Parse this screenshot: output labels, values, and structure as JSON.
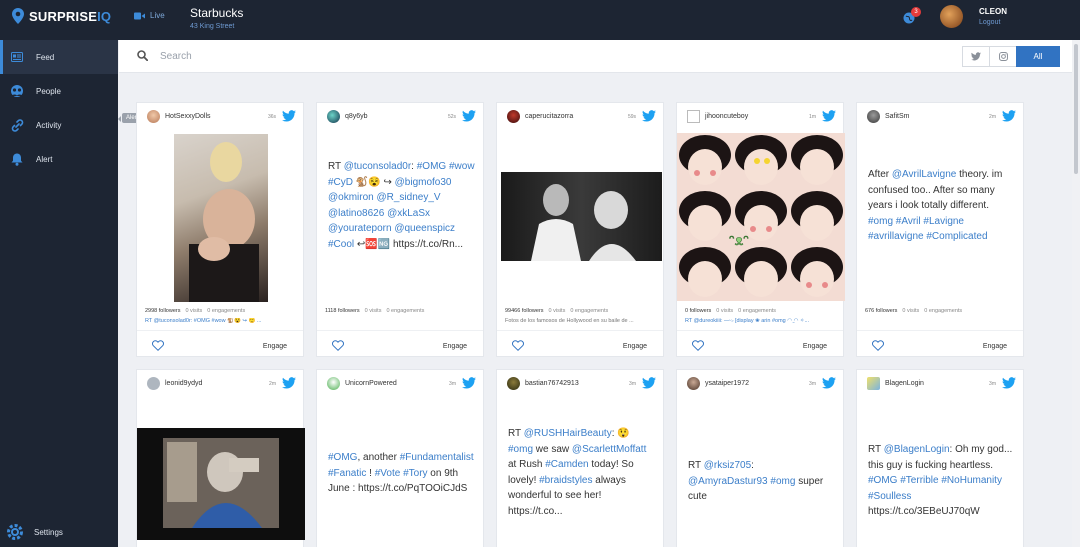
{
  "app": {
    "brand_part1": "SURPRISE",
    "brand_part2": "IQ",
    "live_label": "Live",
    "store_name": "Starbucks",
    "store_address": "43 King Street"
  },
  "header": {
    "notification_count": "3",
    "user_name": "CLEON",
    "logout_label": "Logout"
  },
  "sidebar": {
    "items": [
      {
        "label": "Feed",
        "icon": "feed-icon"
      },
      {
        "label": "People",
        "icon": "people-icon"
      },
      {
        "label": "Activity",
        "icon": "activity-icon"
      },
      {
        "label": "Alert",
        "icon": "bell-icon"
      }
    ],
    "tooltip": "Alert",
    "settings_label": "Settings"
  },
  "search": {
    "placeholder": "Search",
    "filter_all": "All"
  },
  "colors": {
    "sidebar_bg": "#1d2533",
    "accent": "#3173c2",
    "link": "#3b7ec9",
    "twitter": "#1da1f2"
  },
  "cards": [
    {
      "user": "HotSexxyDolls",
      "time": "36s",
      "followers": "2998 followers",
      "visits": "0 visits",
      "engagements": "0 engagements",
      "snippet": "RT @tuconsolad0r: #OMG #wow 🐒😵 ↪ 🙂 ...",
      "engage": "Engage"
    },
    {
      "user": "q8y6yb",
      "time": "52s",
      "text": "RT @tuconsolad0r: #OMG #wow #CyD 🐒😵 ↪ @bigmofo30 @okmiron @R_sidney_V @latino8626 @xkLaSx @yourateporn @queenspicz #Cool ↩🆘🆖 https://t.co/Rn...",
      "followers": "1118 followers",
      "visits": "0 visits",
      "engagements": "0 engagements",
      "engage": "Engage"
    },
    {
      "user": "caperucitazorra",
      "time": "59s",
      "followers": "99466 followers",
      "visits": "0 visits",
      "engagements": "0 engagements",
      "snippet": "Fotos de los famosos de Hollywood en su baile de ...",
      "engage": "Engage"
    },
    {
      "user": "jihooncuteboy",
      "time": "1m",
      "followers": "0 followers",
      "visits": "0 visits",
      "engagements": "0 engagements",
      "snippet": "RT @dureokiiii: —ᵕ˶̀ [display ❀ arin #omg ◠ ̫◠ ✧...",
      "engage": "Engage"
    },
    {
      "user": "SafitSm",
      "time": "2m",
      "text": "After @AvrilLavigne theory. im confused too.. After so many years i look totally different. #omg #Avril #Lavigne #avrillavigne #Complicated",
      "followers": "676 followers",
      "visits": "0 visits",
      "engagements": "0 engagements",
      "engage": "Engage"
    },
    {
      "user": "leonid9ydyd",
      "time": "2m"
    },
    {
      "user": "UnicornPowered",
      "time": "3m",
      "text": "#OMG, another #Fundamentalist #Fanatic ! #Vote #Tory on 9th June : https://t.co/PqTOOiCJdS"
    },
    {
      "user": "bastian76742913",
      "time": "3m",
      "text": "RT @RUSHHairBeauty: 😲 #omg we saw @ScarlettMoffatt at Rush #Camden today! So lovely! #braidstyles always wonderful to see her! https://t.co..."
    },
    {
      "user": "ysataiper1972",
      "time": "3m",
      "text": "RT @rksiz705: @AmyraDastur93 #omg super cute"
    },
    {
      "user": "BlagenLogin",
      "time": "3m",
      "text": "RT @BlagenLogin: Oh my god... this guy is fucking heartless. #OMG #Terrible #NoHumanity #Soulless https://t.co/3EBeUJ70qW"
    }
  ]
}
